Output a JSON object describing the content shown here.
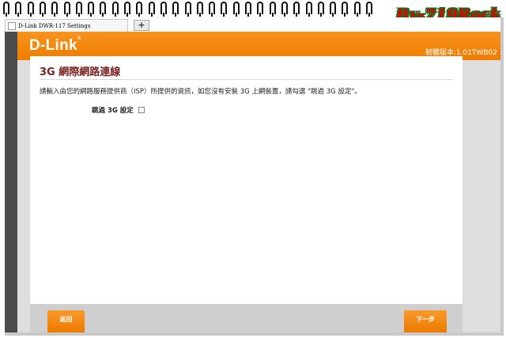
{
  "watermark": "By-719Rock",
  "browser": {
    "tab_title": "D-Link DWR-117 Settings",
    "new_tab_icon": "plus-icon"
  },
  "header": {
    "logo": "D-Link",
    "logo_mark": "®",
    "firmware_label": "韌體版本:",
    "firmware_value": "1.01TWB02",
    "brand_color": "#f7931e"
  },
  "panel": {
    "title": "3G 網際網路連線",
    "title_color": "#7b2323",
    "instructions": "請輸入由您的網路服務提供商（ISP）所提供的資訊，如您沒有安裝 3G 上網裝置，請勾選 \"跳過 3G 設定\"。",
    "skip_label": "跳過 3G 設定",
    "skip_checked": false
  },
  "buttons": {
    "back": "返回",
    "next": "下一步"
  }
}
